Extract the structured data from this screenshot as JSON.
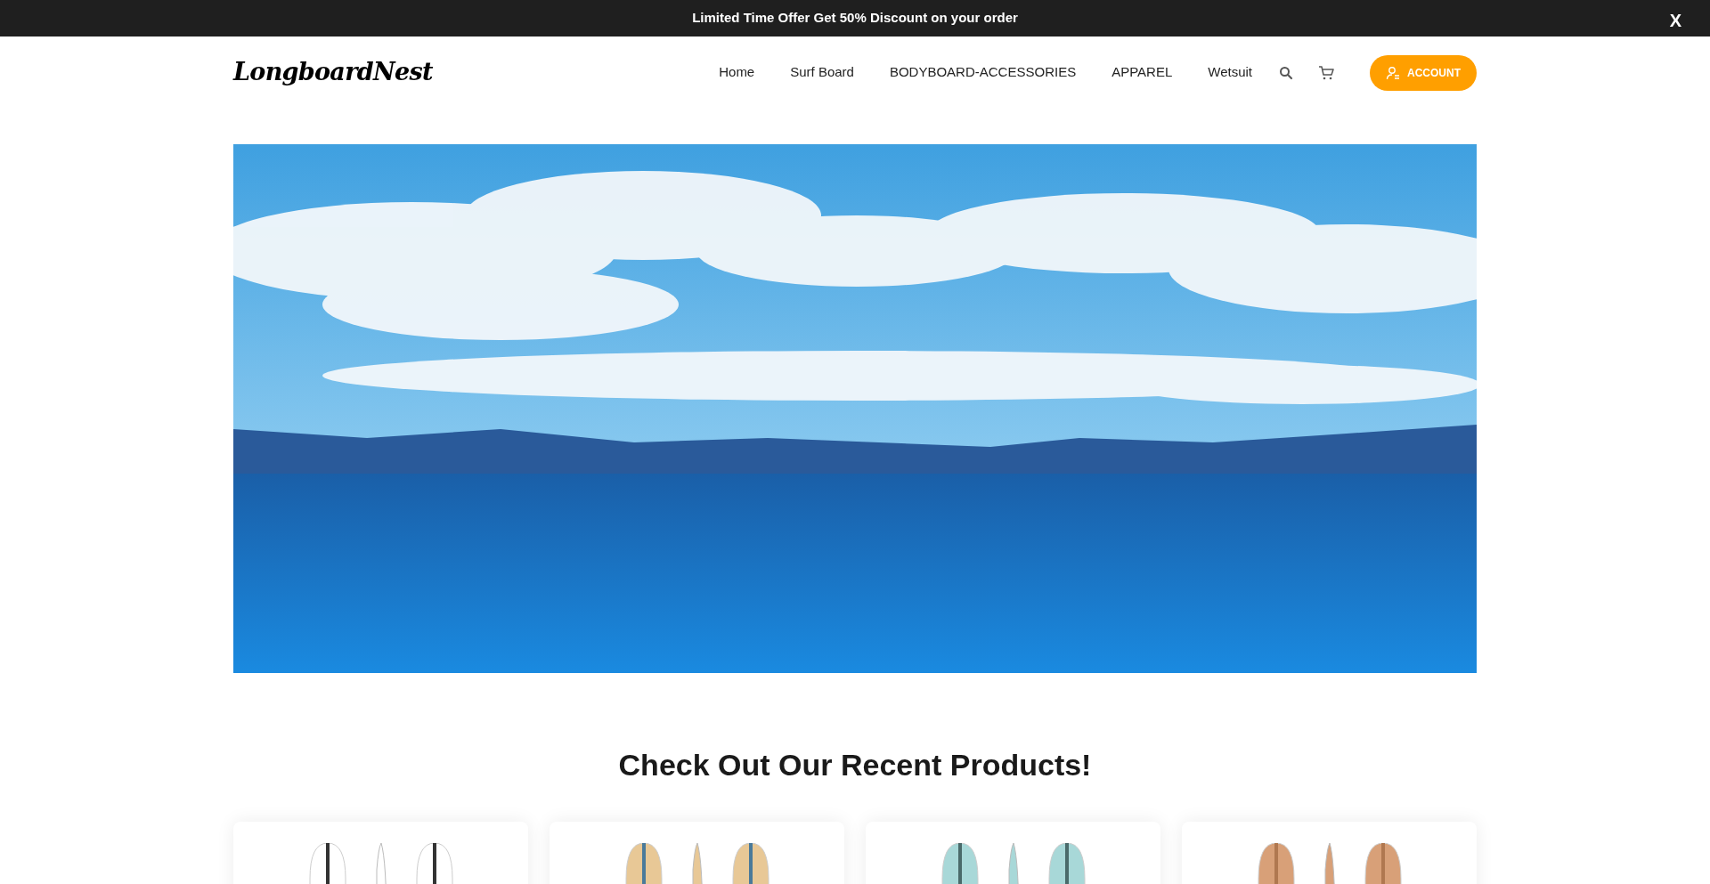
{
  "announcement": {
    "text": "Limited Time Offer Get 50% Discount on your order",
    "close": "X"
  },
  "logo": "LongboardNest",
  "nav": [
    {
      "label": "Home"
    },
    {
      "label": "Surf Board"
    },
    {
      "label": "BODYBOARD-ACCESSORIES"
    },
    {
      "label": "APPAREL"
    },
    {
      "label": "Wetsuit"
    }
  ],
  "account_button": "ACCOUNT",
  "section_title": "Check Out Our Recent Products!"
}
